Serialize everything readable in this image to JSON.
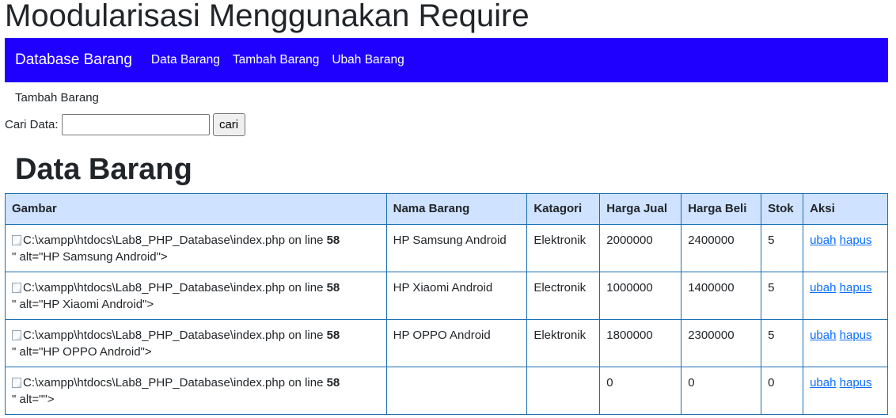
{
  "page_title": "Moodularisasi Menggunakan Require",
  "navbar": {
    "brand": "Database Barang",
    "links": [
      "Data Barang",
      "Tambah Barang",
      "Ubah Barang"
    ]
  },
  "sub_link": "Tambah Barang",
  "search": {
    "label": "Cari Data:",
    "value": "",
    "button_label": "cari"
  },
  "section_title": "Data Barang",
  "table": {
    "headers": [
      "Gambar",
      "Nama Barang",
      "Katagori",
      "Harga Jual",
      "Harga Beli",
      "Stok",
      "Aksi"
    ],
    "rows": [
      {
        "img_text": "C:\\xampp\\htdocs\\Lab8_PHP_Database\\index.php on line ",
        "line": "58",
        "alt_text": "\" alt=\"HP Samsung Android\">",
        "nama": "HP Samsung Android",
        "kategori": "Elektronik",
        "harga_jual": "2000000",
        "harga_beli": "2400000",
        "stok": "5",
        "ubah": "ubah",
        "hapus": "hapus"
      },
      {
        "img_text": "C:\\xampp\\htdocs\\Lab8_PHP_Database\\index.php on line ",
        "line": "58",
        "alt_text": "\" alt=\"HP Xiaomi Android\">",
        "nama": "HP Xiaomi Android",
        "kategori": "Electronik",
        "harga_jual": "1000000",
        "harga_beli": "1400000",
        "stok": "5",
        "ubah": "ubah",
        "hapus": "hapus"
      },
      {
        "img_text": "C:\\xampp\\htdocs\\Lab8_PHP_Database\\index.php on line ",
        "line": "58",
        "alt_text": "\" alt=\"HP OPPO Android\">",
        "nama": "HP OPPO Android",
        "kategori": "Elektronik",
        "harga_jual": "1800000",
        "harga_beli": "2300000",
        "stok": "5",
        "ubah": "ubah",
        "hapus": "hapus"
      },
      {
        "img_text": "C:\\xampp\\htdocs\\Lab8_PHP_Database\\index.php on line ",
        "line": "58",
        "alt_text": "\" alt=\"\">",
        "nama": "",
        "kategori": "",
        "harga_jual": "0",
        "harga_beli": "0",
        "stok": "0",
        "ubah": "ubah",
        "hapus": "hapus"
      }
    ]
  },
  "colors": {
    "navbar_bg": "#1f00ff",
    "table_header_bg": "#cfe2ff",
    "table_border": "#1a6fb3",
    "link": "#0d6efd"
  }
}
